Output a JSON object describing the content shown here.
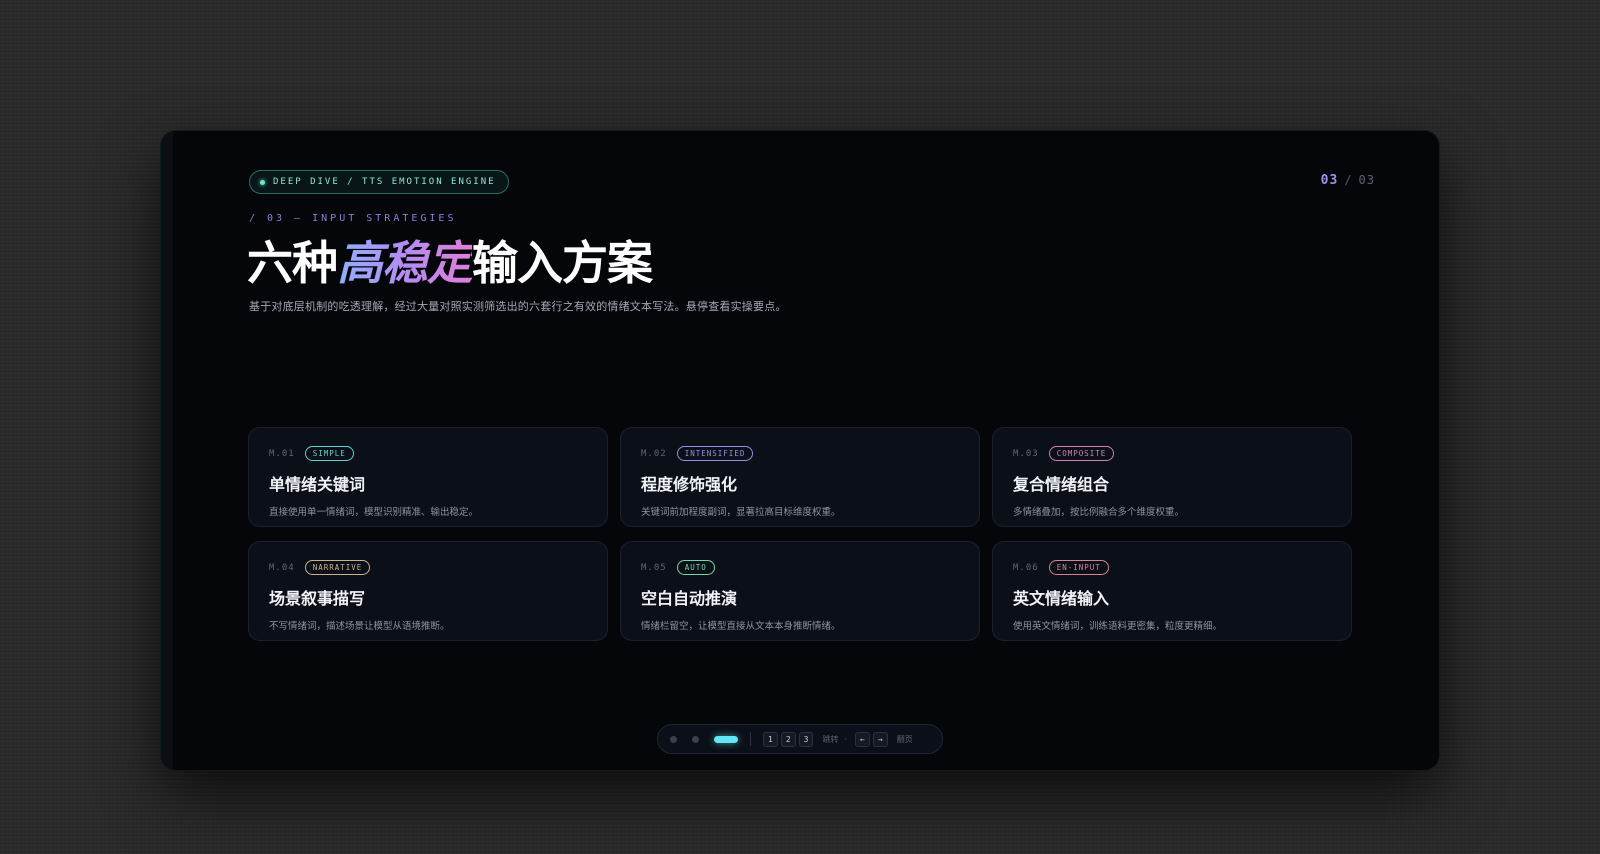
{
  "header": {
    "badge": "DEEP DIVE / TTS EMOTION ENGINE",
    "page_current": "03",
    "page_separator": "/",
    "page_total": "03",
    "eyebrow": "/ 03 — INPUT STRATEGIES",
    "title_pre": "六种",
    "title_highlight": "高稳定",
    "title_post": "输入方案",
    "subtitle": "基于对底层机制的吃透理解，经过大量对照实测筛选出的六套行之有效的情绪文本写法。悬停查看实操要点。"
  },
  "cards": [
    {
      "num": "M.01",
      "tag": "SIMPLE",
      "title": "单情绪关键词",
      "desc": "直接使用单一情绪词，模型识别精准、输出稳定。"
    },
    {
      "num": "M.02",
      "tag": "INTENSIFIED",
      "title": "程度修饰强化",
      "desc": "关键词前加程度副词，显著拉高目标维度权重。"
    },
    {
      "num": "M.03",
      "tag": "COMPOSITE",
      "title": "复合情绪组合",
      "desc": "多情绪叠加，按比例融合多个维度权重。"
    },
    {
      "num": "M.04",
      "tag": "NARRATIVE",
      "title": "场景叙事描写",
      "desc": "不写情绪词，描述场景让模型从语境推断。"
    },
    {
      "num": "M.05",
      "tag": "AUTO",
      "title": "空白自动推演",
      "desc": "情绪栏留空，让模型直接从文本本身推断情绪。"
    },
    {
      "num": "M.06",
      "tag": "EN-INPUT",
      "title": "英文情绪输入",
      "desc": "使用英文情绪词，训练语料更密集，粒度更精细。"
    }
  ],
  "tag_colors": {
    "SIMPLE": "#5fd4cf",
    "INTENSIFIED": "#9a8ce8",
    "COMPOSITE": "#d27fb8",
    "NARRATIVE": "#cbb489",
    "AUTO": "#6fd9a8",
    "EN-INPUT": "#d8838e"
  },
  "nav": {
    "key1": "1",
    "key2": "2",
    "key3": "3",
    "jump_label": "跳转",
    "dash": "·",
    "prev_key": "←",
    "next_key": "→",
    "flip_label": "翻页"
  }
}
